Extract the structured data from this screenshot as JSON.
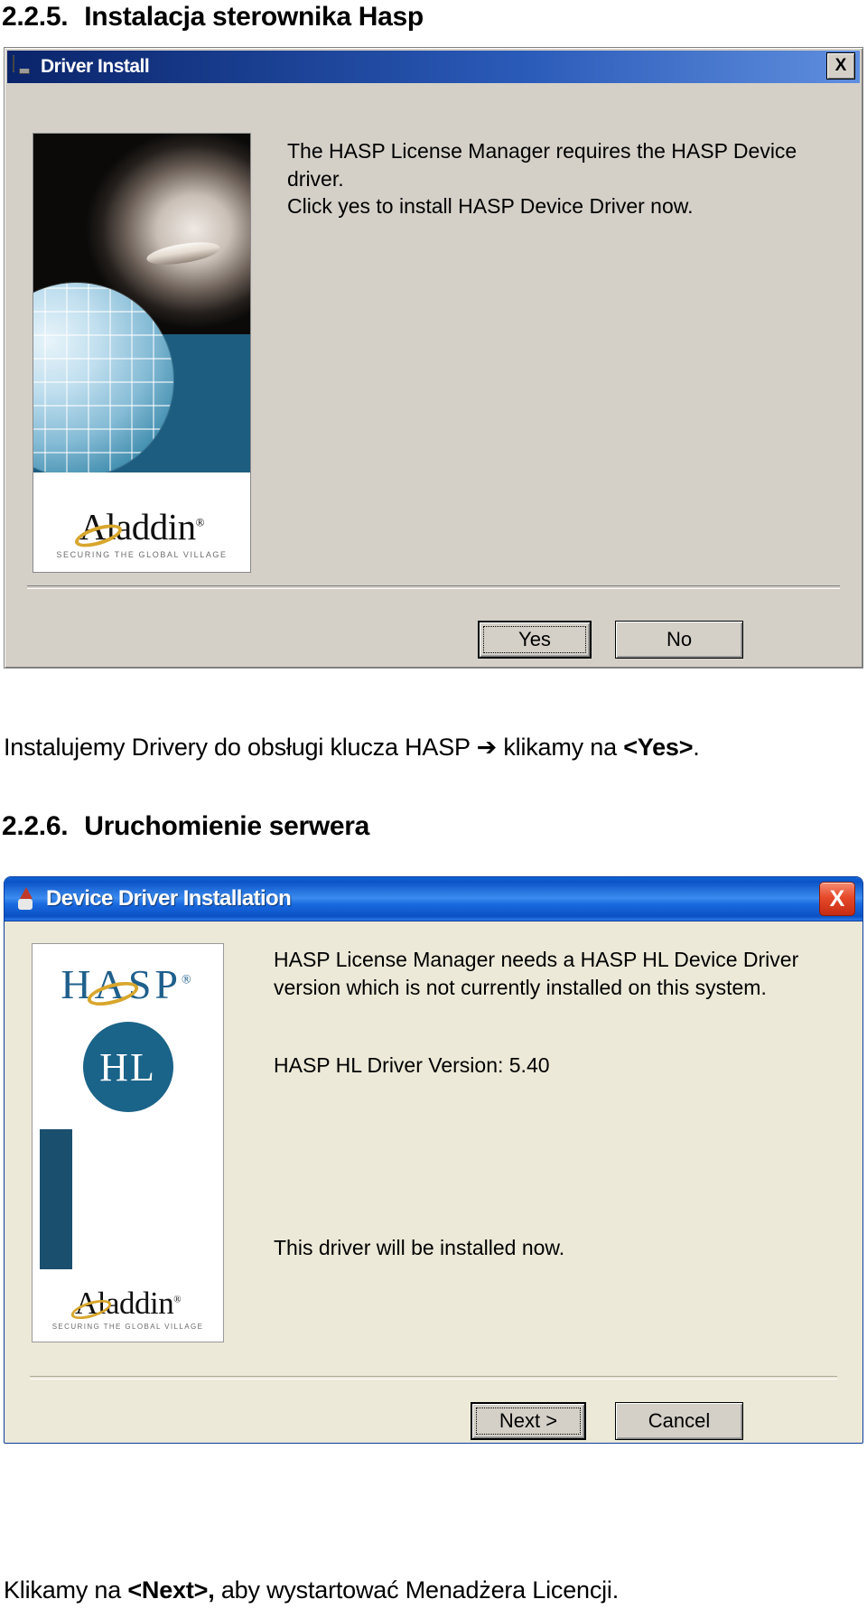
{
  "document": {
    "section_225": {
      "number": "2.2.5.",
      "title": "Instalacja sterownika Hasp"
    },
    "section_226": {
      "number": "2.2.6.",
      "title": "Uruchomienie serwera"
    },
    "caption_1_plain_before": "Instalujemy Drivery do obsługi klucza HASP ➔ klikamy na ",
    "caption_1_bold": "<Yes>",
    "caption_1_plain_after": ".",
    "caption_2_plain_before": "Klikamy na ",
    "caption_2_bold": "<Next>,",
    "caption_2_plain_after": " aby wystartować Menadżera Licencji."
  },
  "dialog_driver_install": {
    "title": "Driver Install",
    "titlebar_icon": "hasp-key-icon",
    "close_label": "X",
    "message_line_1": "The HASP License Manager requires the HASP Device",
    "message_line_2": "driver.",
    "message_line_3": "Click yes to install HASP Device Driver now.",
    "splash": {
      "brand_word": "Aladdin",
      "brand_trademark": "®",
      "tagline": "SECURING THE GLOBAL VILLAGE"
    },
    "buttons": {
      "yes": "Yes",
      "no": "No"
    },
    "default_button": "Yes",
    "colors": {
      "titlebar_start": "#0a246a",
      "titlebar_end": "#5f8ede",
      "face": "#d4d0c8",
      "brand_blue": "#1d5e80",
      "ring_gold": "#d8a62c"
    }
  },
  "dialog_device_driver_installation": {
    "title": "Device Driver Installation",
    "titlebar_icon": "wizard-icon",
    "close_label": "X",
    "message_line_1": "HASP License Manager needs a HASP HL Device Driver",
    "message_line_2": "version which is not currently installed on this system.",
    "version_text": "HASP HL Driver Version: 5.40",
    "note_text": "This driver will be installed now.",
    "panel": {
      "product_word": "HASP",
      "product_trademark": "®",
      "product_edition": "HL",
      "brand_word": "Aladdin",
      "brand_trademark": "®",
      "tagline": "SECURING THE GLOBAL VILLAGE"
    },
    "buttons": {
      "next": "Next >",
      "cancel": "Cancel"
    },
    "default_button": "Next >",
    "colors": {
      "titlebar_start": "#1364d6",
      "titlebar_mid": "#3b8bef",
      "face": "#ece9d8",
      "close_red": "#e64a2b",
      "product_blue": "#1a6389"
    }
  }
}
